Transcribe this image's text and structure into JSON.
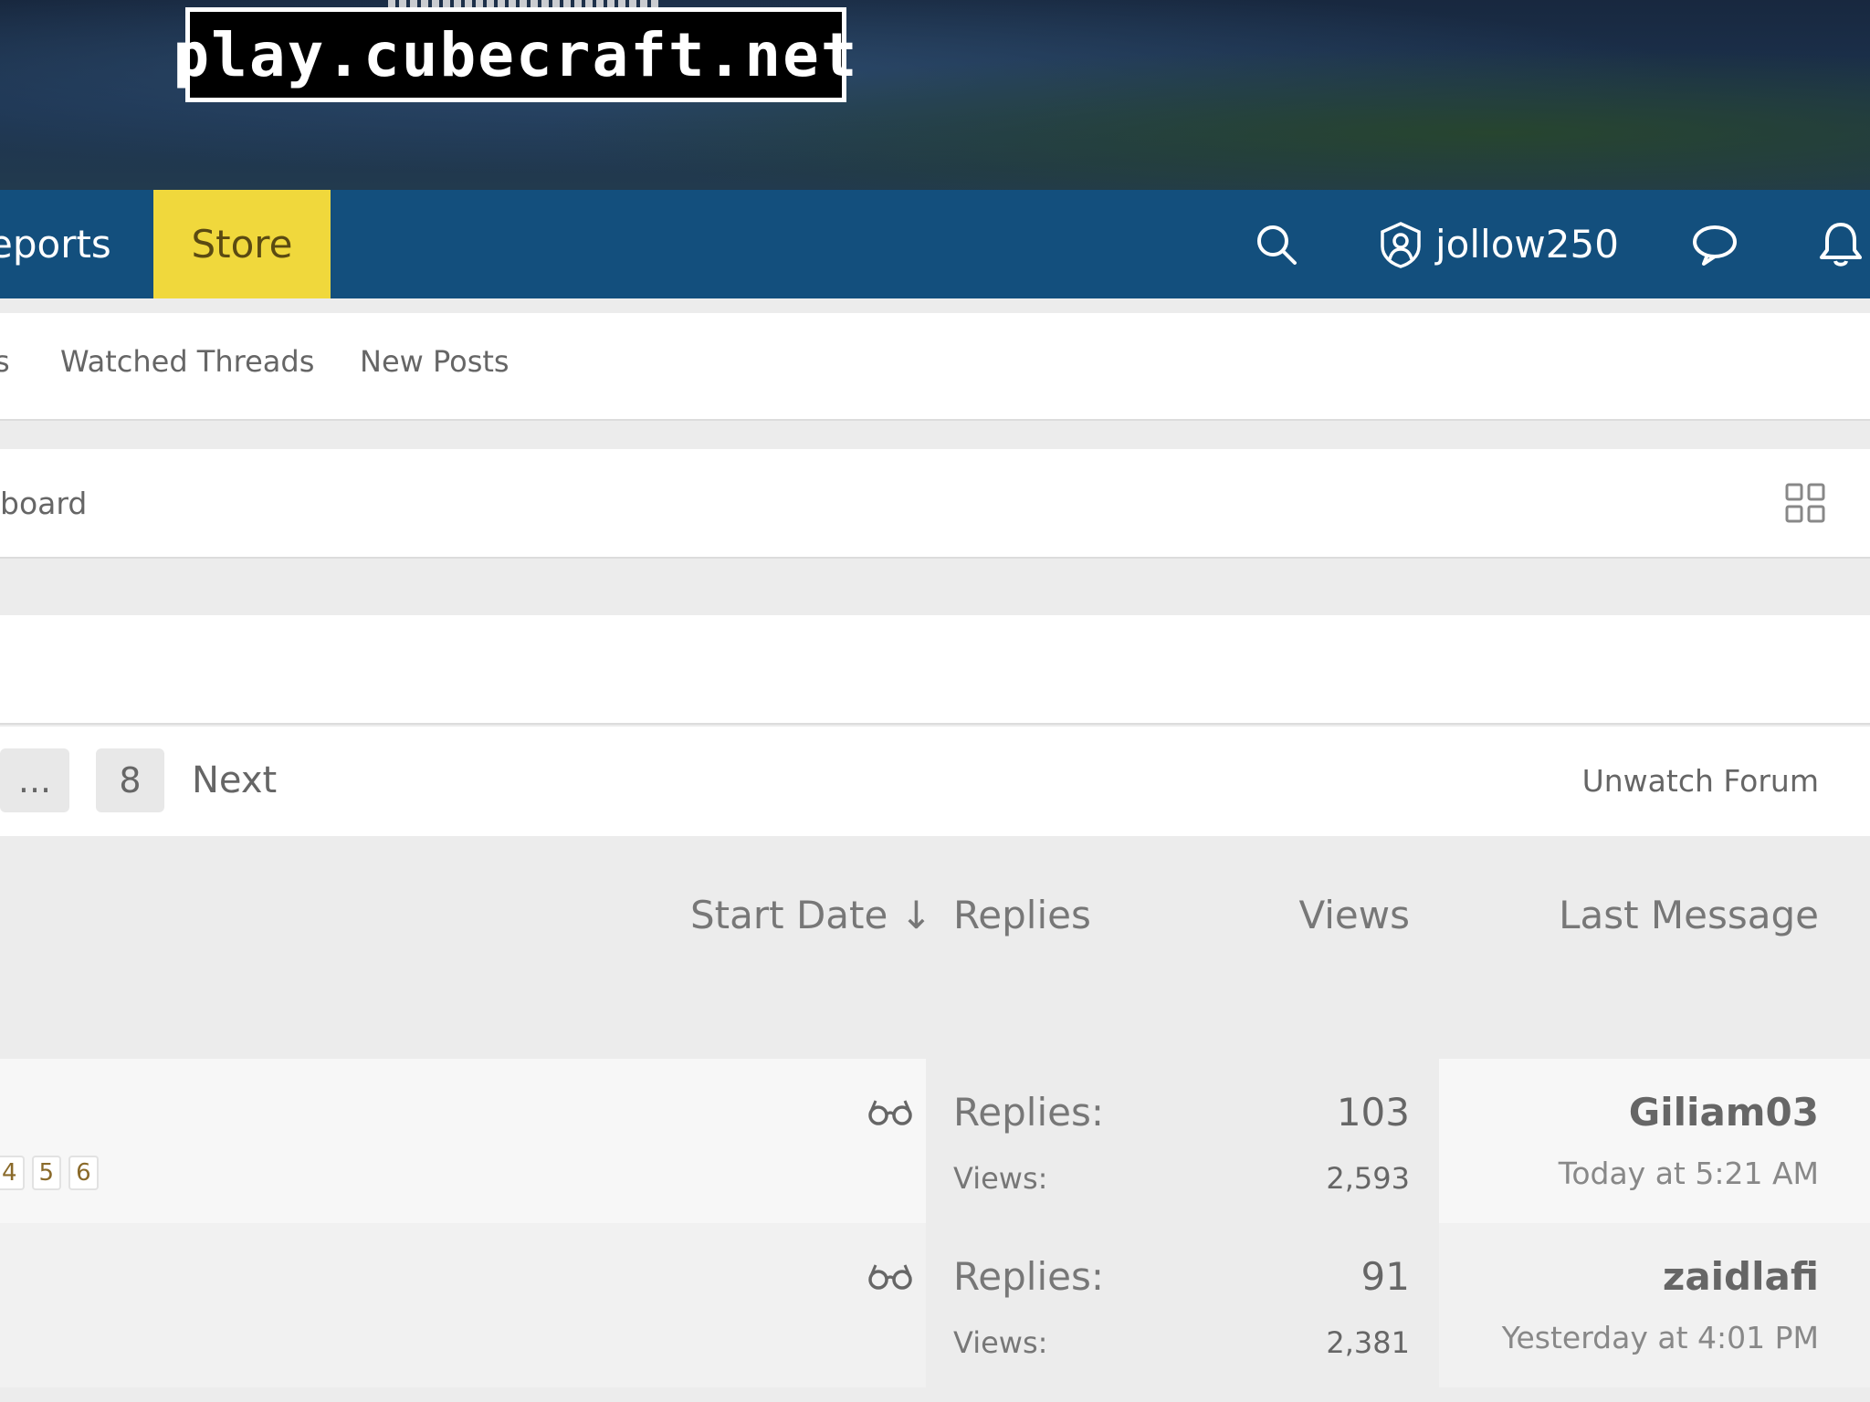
{
  "banner": {
    "logo_text": "play.cubecraft.net"
  },
  "nav": {
    "reports_label": "eports",
    "store_label": "Store",
    "username": "jollow250",
    "icons": [
      "search-icon",
      "user-shield-icon",
      "conversation-icon",
      "bell-icon"
    ],
    "store_color": "#f0d83c",
    "bar_color": "#134f7d"
  },
  "subnav": {
    "edge_text": "s",
    "links": [
      "Watched Threads",
      "New Posts"
    ]
  },
  "breadcrumb": {
    "text": "board"
  },
  "pager": {
    "ellipsis": "...",
    "page_8": "8",
    "next_label": "Next",
    "unwatch_label": "Unwatch Forum"
  },
  "columns": {
    "start_date": "Start Date ↓",
    "replies": "Replies",
    "views": "Views",
    "last_message": "Last Message"
  },
  "threads": [
    {
      "pages": [
        "4",
        "5",
        "6"
      ],
      "replies_label": "Replies:",
      "replies": "103",
      "views_label": "Views:",
      "views": "2,593",
      "last_user": "Giliam03",
      "last_time": "Today at 5:21 AM"
    },
    {
      "replies_label": "Replies:",
      "replies": "91",
      "views_label": "Views:",
      "views": "2,381",
      "last_user": "zaidlafi",
      "last_time": "Yesterday at 4:01 PM"
    }
  ]
}
